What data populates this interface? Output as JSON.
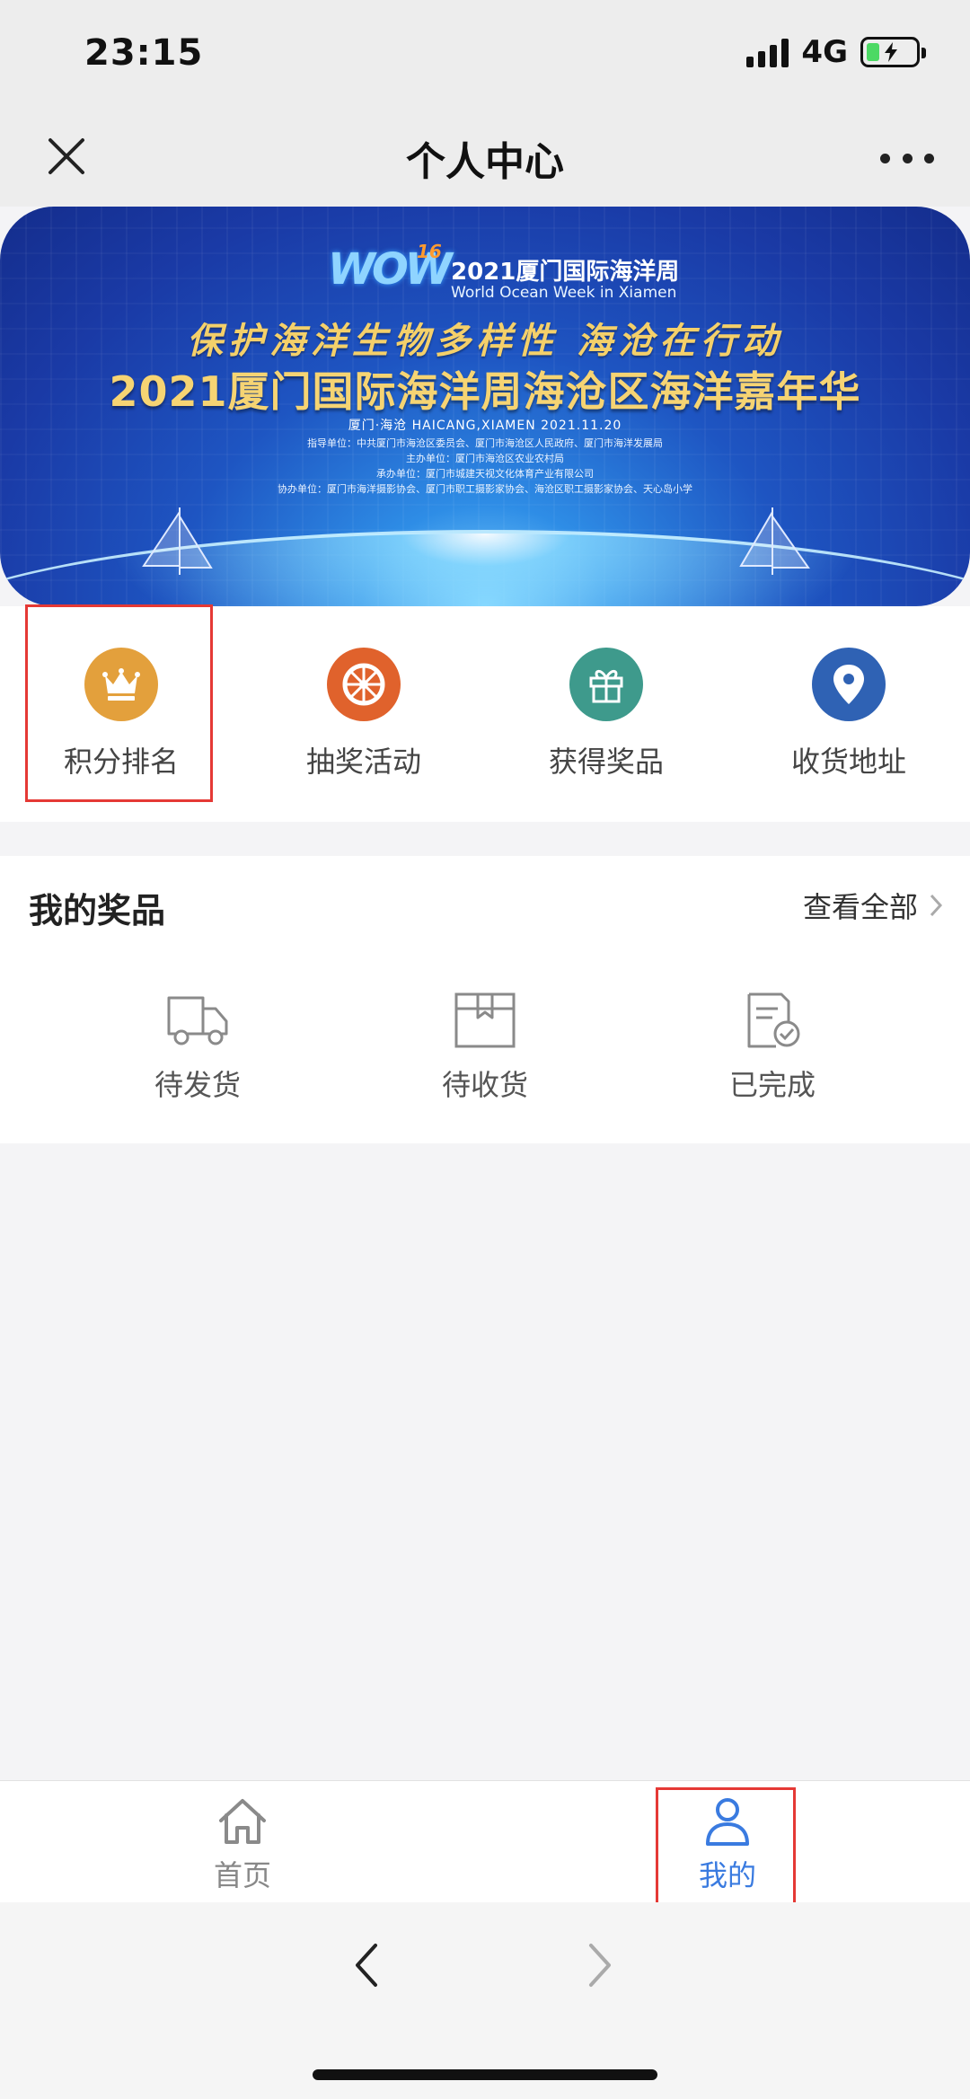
{
  "status_bar": {
    "time": "23:15",
    "network": "4G"
  },
  "title_bar": {
    "title": "个人中心"
  },
  "banner": {
    "wow_cn": "2021厦门国际海洋周",
    "wow_en": "World Ocean Week in Xiamen",
    "wow_logo": "WOW",
    "wow_edition": "16",
    "slogan": "保护海洋生物多样性 海沧在行动",
    "headline": "2021厦门国际海洋周海沧区海洋嘉年华",
    "date_line": "厦门·海沧 HAICANG,XIAMEN  2021.11.20",
    "org_lines": [
      "指导单位：中共厦门市海沧区委员会、厦门市海沧区人民政府、厦门市海洋发展局",
      "主办单位：厦门市海沧区农业农村局",
      "承办单位：厦门市城建天视文化体育产业有限公司",
      "协办单位：厦门市海洋摄影协会、厦门市职工摄影家协会、海沧区职工摄影家协会、天心岛小学"
    ]
  },
  "quick_menu": [
    {
      "label": "积分排名",
      "icon": "crown-icon",
      "color": "#e3a03c"
    },
    {
      "label": "抽奖活动",
      "icon": "wheel-icon",
      "color": "#e0622c"
    },
    {
      "label": "获得奖品",
      "icon": "gift-icon",
      "color": "#3e9a8c"
    },
    {
      "label": "收货地址",
      "icon": "location-pin-icon",
      "color": "#2f62b4"
    }
  ],
  "prizes": {
    "title": "我的奖品",
    "view_all": "查看全部",
    "items": [
      {
        "label": "待发货",
        "icon": "truck-icon"
      },
      {
        "label": "待收货",
        "icon": "package-icon"
      },
      {
        "label": "已完成",
        "icon": "document-check-icon"
      }
    ]
  },
  "tabbar": [
    {
      "label": "首页",
      "icon": "home-icon",
      "active": false
    },
    {
      "label": "我的",
      "icon": "user-icon",
      "active": true
    }
  ],
  "colors": {
    "accent": "#3a7be0",
    "highlight": "#e53935"
  }
}
